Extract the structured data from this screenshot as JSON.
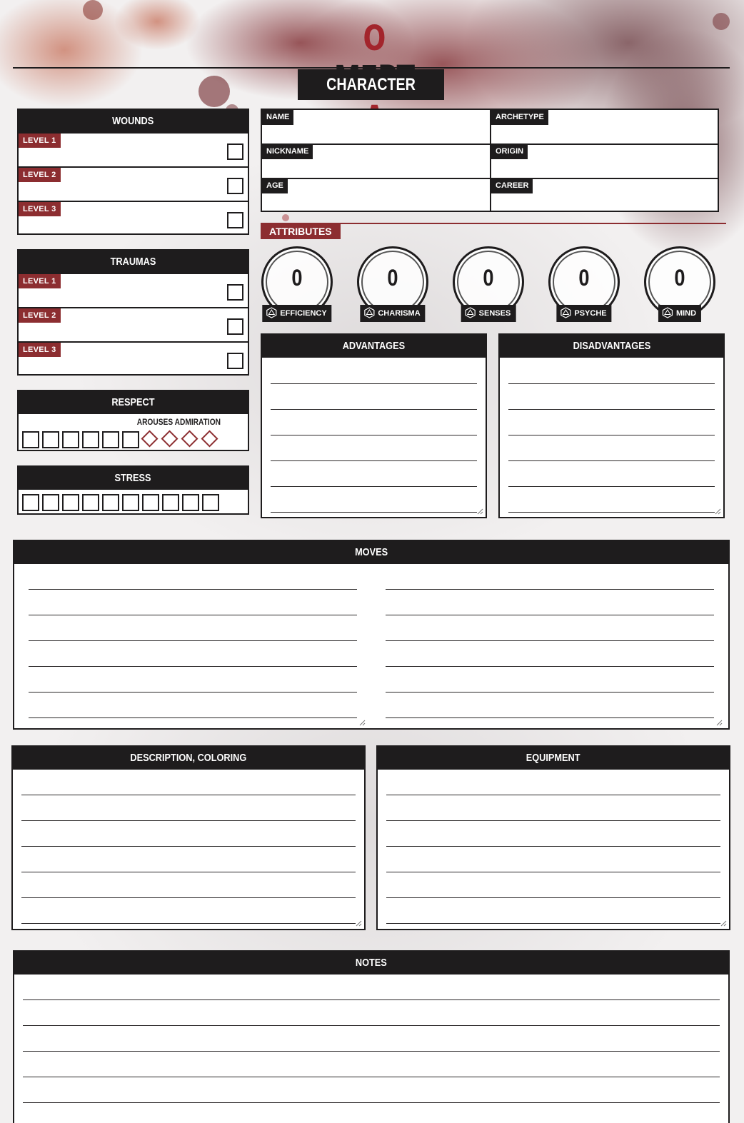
{
  "header": {
    "logo": "OMERTA",
    "title": "CHARACTER SHEET"
  },
  "wounds": {
    "title": "WOUNDS",
    "levels": [
      "LEVEL 1",
      "LEVEL 2",
      "LEVEL 3"
    ]
  },
  "traumas": {
    "title": "TRAUMAS",
    "levels": [
      "LEVEL 1",
      "LEVEL 2",
      "LEVEL 3"
    ]
  },
  "respect": {
    "title": "RESPECT",
    "admiration_label": "AROUSES ADMIRATION",
    "squares": 6,
    "diamonds": 4
  },
  "stress": {
    "title": "STRESS",
    "boxes": 10
  },
  "info": {
    "name": {
      "label": "NAME",
      "value": ""
    },
    "archetype": {
      "label": "ARCHETYPE",
      "value": ""
    },
    "nickname": {
      "label": "NICKNAME",
      "value": ""
    },
    "origin": {
      "label": "ORIGIN",
      "value": ""
    },
    "age": {
      "label": "AGE",
      "value": ""
    },
    "career": {
      "label": "CAREER",
      "value": ""
    }
  },
  "attributes": {
    "title": "ATTRIBUTES",
    "items": [
      {
        "label": "EFFICIENCY",
        "value": "0"
      },
      {
        "label": "CHARISMA",
        "value": "0"
      },
      {
        "label": "SENSES",
        "value": "0"
      },
      {
        "label": "PSYCHE",
        "value": "0"
      },
      {
        "label": "MIND",
        "value": "0"
      }
    ]
  },
  "advantages": {
    "title": "ADVANTAGES"
  },
  "disadvantages": {
    "title": "DISADVANTAGES"
  },
  "moves": {
    "title": "MOVES"
  },
  "description": {
    "title": "DESCRIPTION, COLORING"
  },
  "equipment": {
    "title": "EQUIPMENT"
  },
  "notes": {
    "title": "NOTES"
  },
  "colors": {
    "ink": "#1e1c1d",
    "blood_red": "#8c2d30",
    "logo_red": "#a3252c",
    "paper": "#f1efef"
  }
}
